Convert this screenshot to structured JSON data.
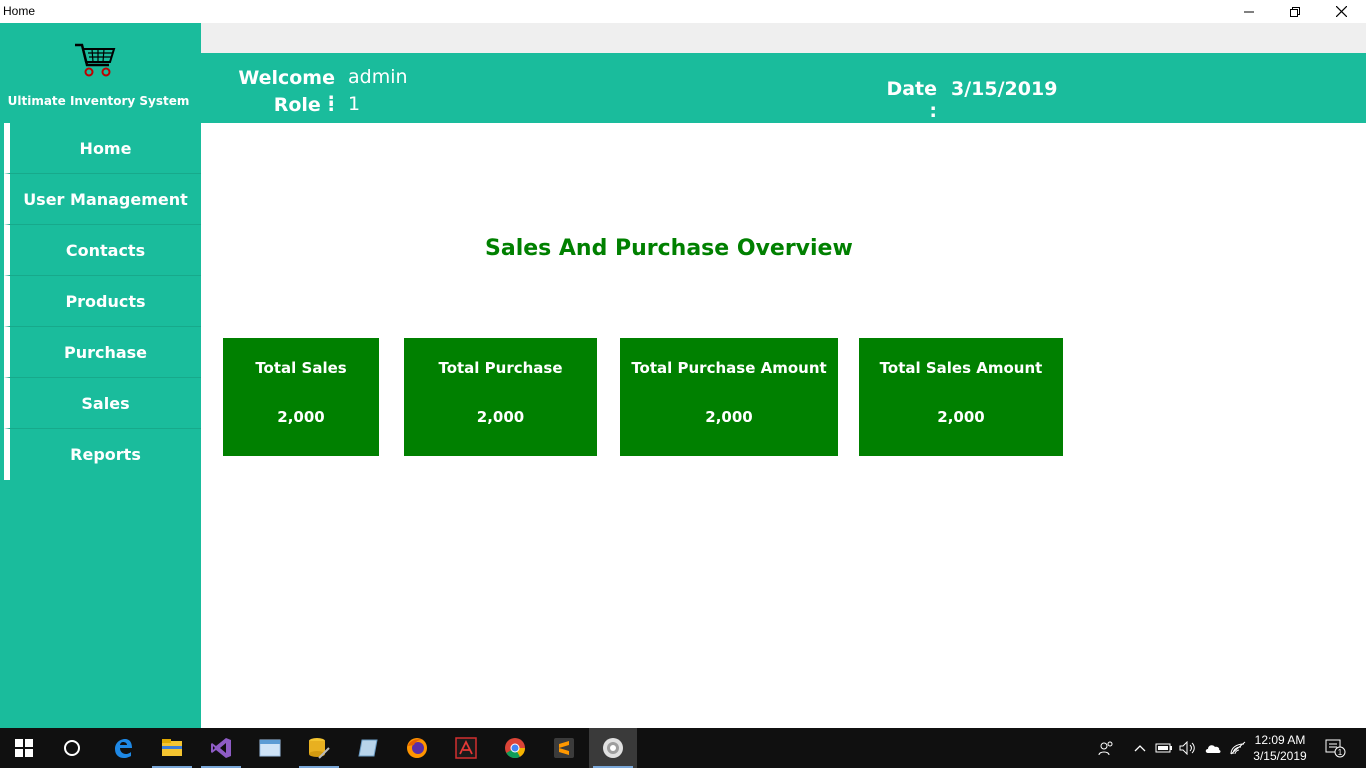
{
  "window": {
    "title": "Home"
  },
  "sidebar": {
    "app_name": "Ultimate Inventory System",
    "items": [
      {
        "label": "Home"
      },
      {
        "label": "User Management"
      },
      {
        "label": "Contacts"
      },
      {
        "label": "Products"
      },
      {
        "label": "Purchase"
      },
      {
        "label": "Sales"
      },
      {
        "label": "Reports"
      }
    ]
  },
  "header": {
    "welcome_label": "Welcome :",
    "welcome_value": "admin",
    "role_label": "Role :",
    "role_value": "1",
    "date_label": "Date :",
    "date_value": "3/15/2019"
  },
  "main": {
    "title": "Sales And Purchase Overview",
    "cards": [
      {
        "title": "Total Sales",
        "value": "2,000"
      },
      {
        "title": "Total Purchase",
        "value": "2,000"
      },
      {
        "title": "Total Purchase Amount",
        "value": "2,000"
      },
      {
        "title": "Total Sales Amount",
        "value": "2,000"
      }
    ]
  },
  "taskbar": {
    "clock_time": "12:09 AM",
    "clock_date": "3/15/2019",
    "notification_count": "1",
    "icons": [
      "windows-start-icon",
      "cortana-search-icon",
      "edge-icon",
      "file-explorer-icon",
      "visual-studio-icon",
      "window-app-icon",
      "database-tool-icon",
      "notes-icon",
      "firefox-icon",
      "acrobat-icon",
      "chrome-icon",
      "sublime-text-icon",
      "running-app-icon"
    ]
  },
  "colors": {
    "primary": "#1abc9c",
    "card": "#008000",
    "title_text": "#008000",
    "strip": "#efefef",
    "taskbar": "#101010"
  }
}
